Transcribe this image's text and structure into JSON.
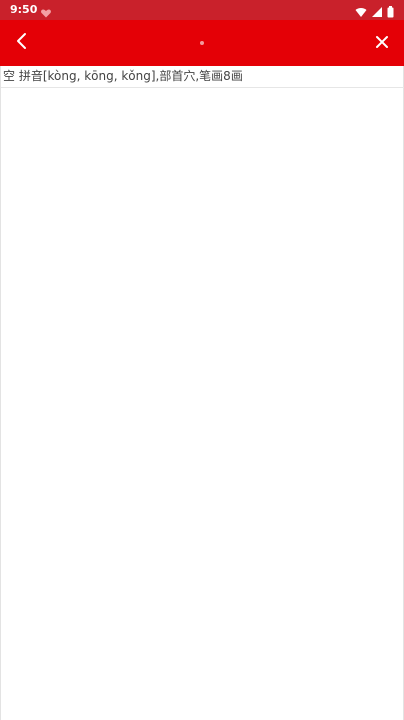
{
  "status_bar": {
    "time": "9:50",
    "icons": [
      "heart-icon",
      "wifi-icon",
      "signal-icon",
      "battery-icon"
    ],
    "bg_color": "#c9212b"
  },
  "app_bar": {
    "title": "",
    "bg_color": "#e40006",
    "back_icon": "chevron-left-icon",
    "close_icon": "close-icon"
  },
  "content": {
    "info_line": "空 拼音[kòng, kōng, kǒng],部首穴,笔画8画"
  }
}
